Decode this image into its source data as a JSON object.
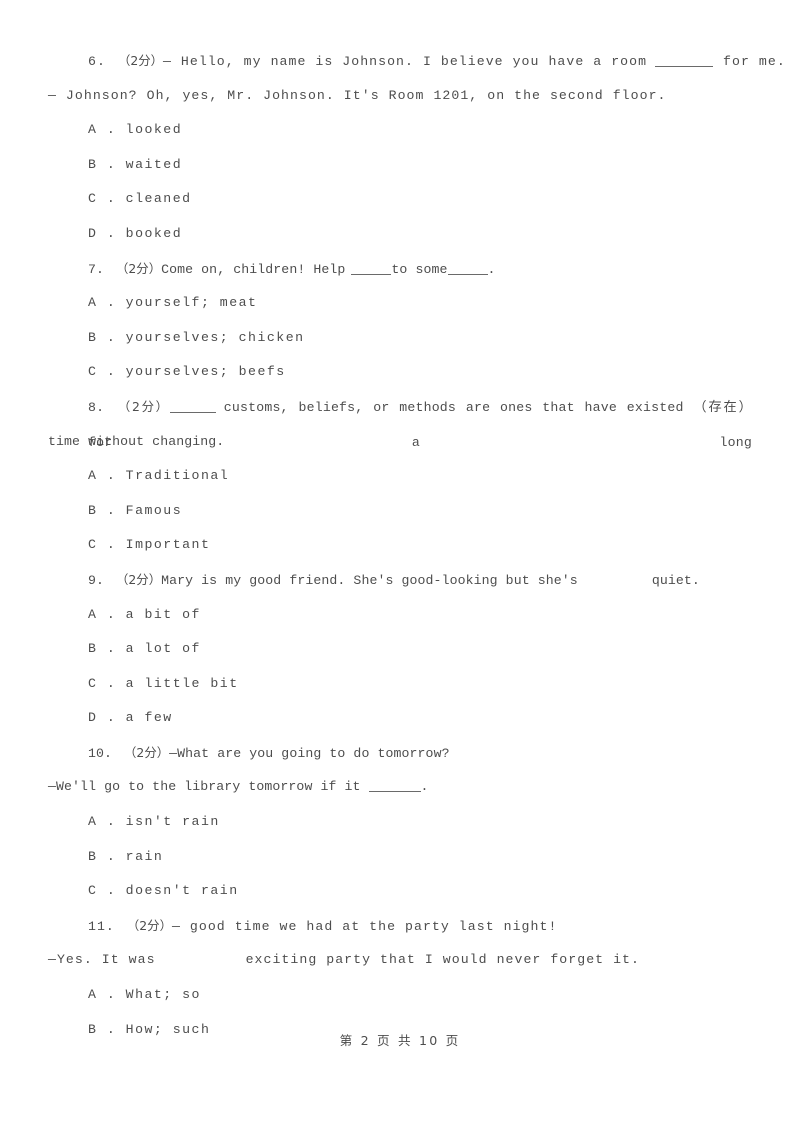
{
  "document": {
    "page_label": "第 2 页 共 10 页",
    "text_color": "#4d4d4d",
    "background_color": "#ffffff"
  },
  "questions": [
    {
      "number": "6.",
      "marks": "（2分）",
      "stem_prefix": "— Hello, my name is Johnson. I believe you have a room",
      "stem_suffix": "for me.",
      "stem_line2": "— Johnson? Oh, yes, Mr. Johnson. It's Room 1201, on the second floor.",
      "options": [
        "A . looked",
        "B . waited",
        "C . cleaned",
        "D . booked"
      ]
    },
    {
      "number": "7.",
      "marks": "（2分）",
      "stem_a": "Come on, children! Help",
      "stem_b": "to some",
      "stem_c": ".",
      "options": [
        "A . yourself; meat",
        "B . yourselves; chicken",
        "C . yourselves; beefs"
      ]
    },
    {
      "number": "8.",
      "marks": "（2分）",
      "stem_after_blank": "customs, beliefs, or methods are ones that have existed （存在） for a long",
      "stem_wrap": "time without changing.",
      "options": [
        "A . Traditional",
        "B . Famous",
        "C . Important"
      ]
    },
    {
      "number": "9.",
      "marks": "（2分）",
      "stem_prefix": "Mary is my good friend. She's good-looking but she's",
      "stem_suffix": "quiet.",
      "options": [
        "A . a bit of",
        "B . a lot of",
        "C . a little bit",
        "D . a few"
      ]
    },
    {
      "number": "10.",
      "marks": "（2分）",
      "stem_line1": "—What are you going to do tomorrow?",
      "stem_line2_prefix": "—We'll go to the library tomorrow if it",
      "stem_line2_suffix": ".",
      "options": [
        "A . isn't rain",
        "B . rain",
        "C . doesn't rain"
      ]
    },
    {
      "number": "11.",
      "marks": "（2分）",
      "stem_line1": "— good time we had at the party last night!",
      "stem_line2_prefix": "—Yes. It was",
      "stem_line2_suffix": "exciting party that I would never forget it.",
      "options": [
        "A . What; so",
        "B . How; such"
      ]
    }
  ]
}
